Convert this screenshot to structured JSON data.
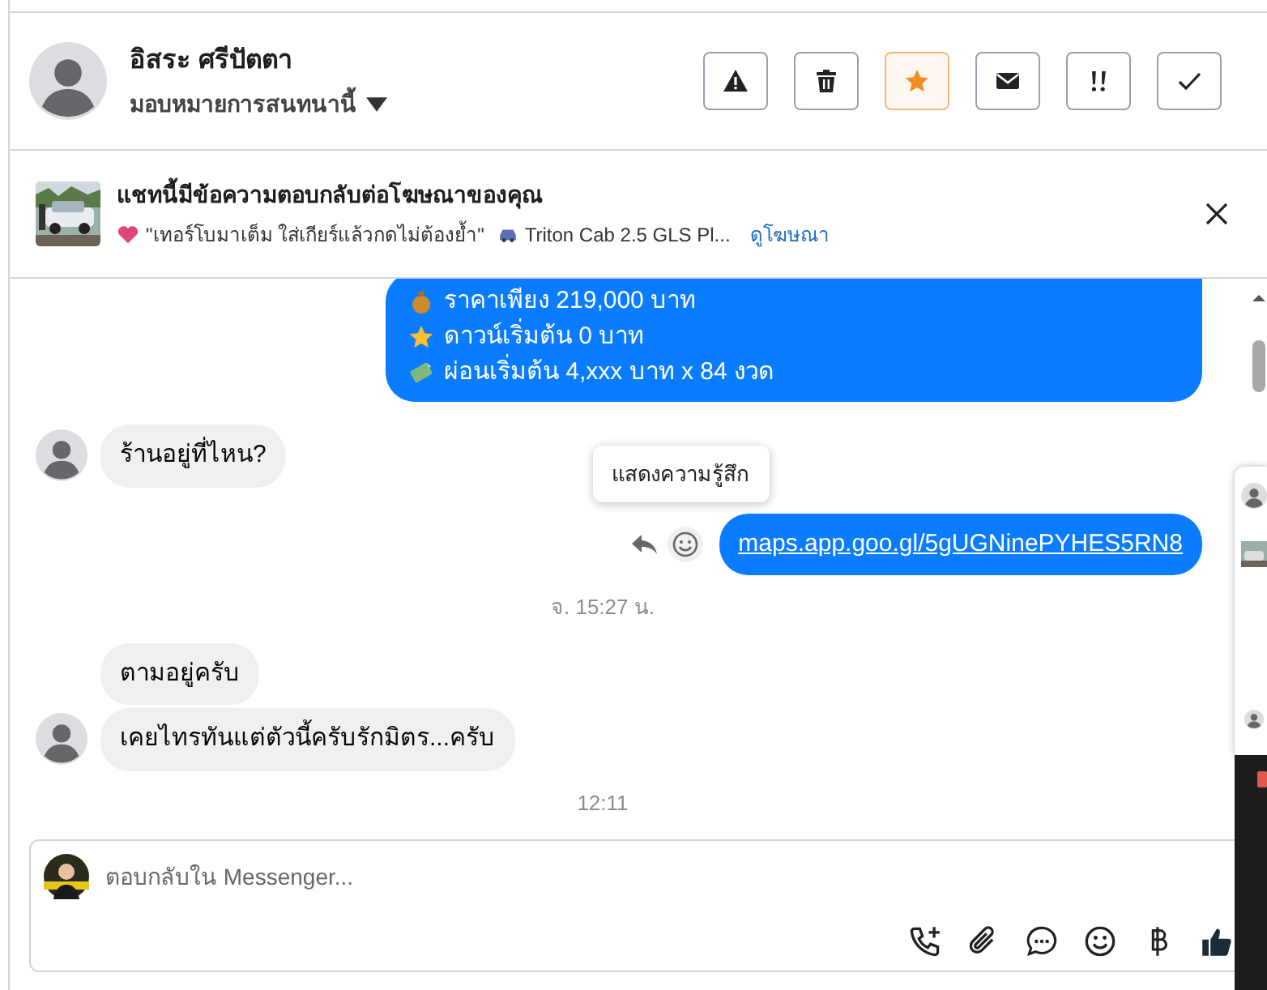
{
  "header": {
    "name": "อิสระ ศรีปัตตา",
    "assign": "มอบหมายการสนทนานี้",
    "buttons": [
      {
        "kind": "warning",
        "active": false
      },
      {
        "kind": "trash",
        "active": false
      },
      {
        "kind": "star",
        "active": true
      },
      {
        "kind": "mail",
        "active": false
      },
      {
        "kind": "important",
        "active": false
      },
      {
        "kind": "check",
        "active": false
      }
    ]
  },
  "ad_banner": {
    "title": "แชทนี้มีข้อความตอบกลับต่อโฆษณาของคุณ",
    "quote": "\"เทอร์โบมาเต็ม ใส่เกียร์แล้วกดไม่ต้องย้ำ\"",
    "product": "Triton Cab 2.5 GLS Pl...",
    "link": "ดูโฆษณา"
  },
  "messages": [
    {
      "kind": "outgoing",
      "lines": [
        {
          "kind": "bag",
          "text": "ราคาเพียง 219,000 บาท"
        },
        {
          "kind": "star",
          "text": "ดาวน์เริ่มต้น 0 บาท"
        },
        {
          "kind": "money",
          "text": "ผ่อนเริ่มต้น 4,xxx บาท x 84 งวด"
        }
      ]
    },
    {
      "kind": "incoming",
      "avatar": true,
      "text": "ร้านอยู่ที่ไหน?"
    },
    {
      "kind": "link",
      "text": "maps.app.goo.gl/5gUGNinePYHES5RN8",
      "tooltip": "แสดงความรู้สึก"
    },
    {
      "kind": "time",
      "text": "จ. 15:27 น."
    },
    {
      "kind": "incoming",
      "avatar": false,
      "text": "ตามอยู่ครับ"
    },
    {
      "kind": "incoming",
      "avatar": true,
      "text": "เคยไทรทันแต่ตัวนี้ครับรักมิตร...ครับ"
    },
    {
      "kind": "time",
      "text": "12:11"
    }
  ],
  "composer": {
    "placeholder": "ตอบกลับใน Messenger..."
  }
}
